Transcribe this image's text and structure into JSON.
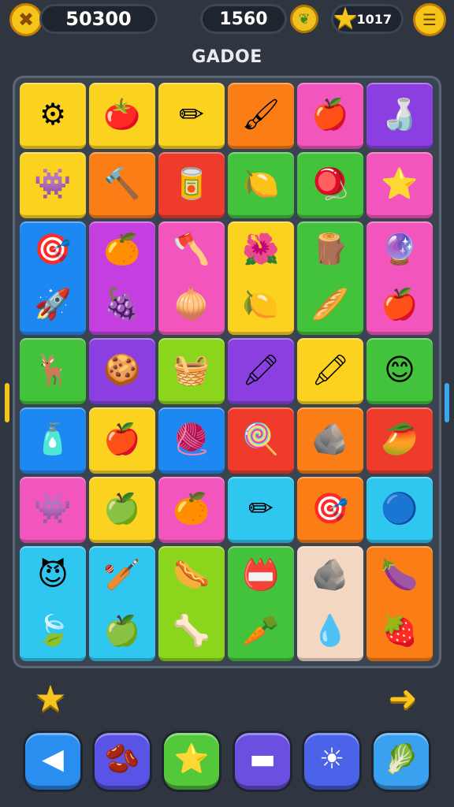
{
  "hud": {
    "score": "50300",
    "moves": "1560",
    "stars": "1017",
    "icons": {
      "menu": "puzzle-icon",
      "leaf": "leaf-coin-icon",
      "star": "star-icon",
      "settings": "settings-icon"
    }
  },
  "title": "GADOE",
  "colors": {
    "yellow": "#fbd21f",
    "orange": "#fa7d16",
    "pink": "#f255bb",
    "purple": "#8b3fe0",
    "red": "#ef3b2c",
    "green": "#43c23c",
    "blue": "#1e88f2",
    "cyan": "#2fc6f0",
    "lime": "#8bd61c",
    "magenta": "#c43ee0",
    "beige": "#f3d7c2"
  },
  "board": {
    "tiles": [
      {
        "color": "yellow",
        "items": [
          {
            "name": "gear-icon",
            "glyph": "⚙"
          }
        ]
      },
      {
        "color": "yellow",
        "items": [
          {
            "name": "tomato-face-icon",
            "glyph": "🍅"
          }
        ]
      },
      {
        "color": "yellow",
        "items": [
          {
            "name": "pen-icon",
            "glyph": "✏"
          }
        ]
      },
      {
        "color": "orange",
        "items": [
          {
            "name": "brush-icon",
            "glyph": "🖌"
          }
        ]
      },
      {
        "color": "pink",
        "items": [
          {
            "name": "apple-icon",
            "glyph": "🍎"
          }
        ]
      },
      {
        "color": "purple",
        "items": [
          {
            "name": "bottle-icon",
            "glyph": "🍶"
          }
        ]
      },
      {
        "color": "yellow",
        "items": [
          {
            "name": "pink-monster-icon",
            "glyph": "👾"
          }
        ]
      },
      {
        "color": "orange",
        "items": [
          {
            "name": "hammer-icon",
            "glyph": "🔨"
          }
        ]
      },
      {
        "color": "red",
        "items": [
          {
            "name": "can-icon",
            "glyph": "🥫"
          }
        ]
      },
      {
        "color": "green",
        "items": [
          {
            "name": "lime-icon",
            "glyph": "🍋"
          }
        ]
      },
      {
        "color": "green",
        "items": [
          {
            "name": "spinning-top-icon",
            "glyph": "🪀"
          }
        ]
      },
      {
        "color": "pink",
        "items": [
          {
            "name": "star-face-icon",
            "glyph": "⭐"
          }
        ]
      },
      {
        "color": "blue",
        "items": [
          {
            "name": "target-icon",
            "glyph": "🎯"
          },
          {
            "name": "rocket-icon",
            "glyph": "🚀"
          }
        ]
      },
      {
        "color": "magenta",
        "items": [
          {
            "name": "orange-icon",
            "glyph": "🍊"
          },
          {
            "name": "plum-icon",
            "glyph": "🍇"
          }
        ]
      },
      {
        "color": "pink",
        "items": [
          {
            "name": "axe-icon",
            "glyph": "🪓"
          },
          {
            "name": "onion-icon",
            "glyph": "🧅"
          }
        ]
      },
      {
        "color": "yellow",
        "items": [
          {
            "name": "flower-icon",
            "glyph": "🌺"
          },
          {
            "name": "lemon-icon",
            "glyph": "🍋"
          }
        ]
      },
      {
        "color": "green",
        "items": [
          {
            "name": "stump-icon",
            "glyph": "🪵"
          },
          {
            "name": "stick-icon",
            "glyph": "🥖"
          }
        ]
      },
      {
        "color": "pink",
        "items": [
          {
            "name": "blue-ball-icon",
            "glyph": "🔮"
          },
          {
            "name": "red-apple-icon",
            "glyph": "🍎"
          }
        ]
      },
      {
        "color": "green",
        "items": [
          {
            "name": "moose-face-icon",
            "glyph": "🦌"
          }
        ]
      },
      {
        "color": "purple",
        "items": [
          {
            "name": "cookie-icon",
            "glyph": "🍪"
          }
        ]
      },
      {
        "color": "lime",
        "items": [
          {
            "name": "basket-icon",
            "glyph": "🧺"
          }
        ]
      },
      {
        "color": "purple",
        "items": [
          {
            "name": "marker-icon",
            "glyph": "🖍"
          }
        ]
      },
      {
        "color": "yellow",
        "items": [
          {
            "name": "crayon-icon",
            "glyph": "🖍"
          }
        ]
      },
      {
        "color": "green",
        "items": [
          {
            "name": "smiley-icon",
            "glyph": "😊"
          }
        ]
      },
      {
        "color": "blue",
        "items": [
          {
            "name": "glue-bottle-icon",
            "glyph": "🧴"
          }
        ]
      },
      {
        "color": "yellow",
        "items": [
          {
            "name": "apple-icon",
            "glyph": "🍎"
          }
        ]
      },
      {
        "color": "blue",
        "items": [
          {
            "name": "yarn-ball-icon",
            "glyph": "🧶"
          }
        ]
      },
      {
        "color": "red",
        "items": [
          {
            "name": "lollipop-icon",
            "glyph": "🍭"
          }
        ]
      },
      {
        "color": "orange",
        "items": [
          {
            "name": "rock-face-icon",
            "glyph": "🪨"
          }
        ]
      },
      {
        "color": "red",
        "items": [
          {
            "name": "mango-icon",
            "glyph": "🥭"
          }
        ]
      },
      {
        "color": "pink",
        "items": [
          {
            "name": "pink-monster-icon",
            "glyph": "👾"
          }
        ]
      },
      {
        "color": "yellow",
        "items": [
          {
            "name": "apple-pin-icon",
            "glyph": "🍏"
          }
        ]
      },
      {
        "color": "pink",
        "items": [
          {
            "name": "orange-icon",
            "glyph": "🍊"
          }
        ]
      },
      {
        "color": "cyan",
        "items": [
          {
            "name": "pencil-icon",
            "glyph": "✏"
          }
        ]
      },
      {
        "color": "orange",
        "items": [
          {
            "name": "target-icon",
            "glyph": "🎯"
          }
        ]
      },
      {
        "color": "cyan",
        "items": [
          {
            "name": "glass-ball-icon",
            "glyph": "🔵"
          }
        ]
      },
      {
        "color": "cyan",
        "items": [
          {
            "name": "purple-monster-icon",
            "glyph": "😈"
          },
          {
            "name": "leaf-icon",
            "glyph": "🍃"
          }
        ]
      },
      {
        "color": "cyan",
        "items": [
          {
            "name": "bat-icon",
            "glyph": "🏏"
          },
          {
            "name": "green-apple-icon",
            "glyph": "🍏"
          }
        ]
      },
      {
        "color": "lime",
        "items": [
          {
            "name": "sausage-icon",
            "glyph": "🌭"
          },
          {
            "name": "bone-icon",
            "glyph": "🦴"
          }
        ]
      },
      {
        "color": "green",
        "items": [
          {
            "name": "badge-icon",
            "glyph": "📛"
          },
          {
            "name": "carrot-icon",
            "glyph": "🥕"
          }
        ]
      },
      {
        "color": "beige",
        "items": [
          {
            "name": "rock-face-icon",
            "glyph": "🪨"
          },
          {
            "name": "blue-drop-icon",
            "glyph": "💧"
          }
        ]
      },
      {
        "color": "orange",
        "items": [
          {
            "name": "purple-fruit-icon",
            "glyph": "🍆"
          },
          {
            "name": "berry-icon",
            "glyph": "🍓"
          }
        ]
      }
    ]
  },
  "controls": {
    "star_button": "star-icon",
    "next_button": "arrow-right-icon",
    "buttons": [
      {
        "name": "back-button",
        "icon": "back-arrow-icon",
        "glyph": "◀",
        "color": "#2a8ef0"
      },
      {
        "name": "bean-button",
        "icon": "bean-icon",
        "glyph": "🫘",
        "color": "#5a54e6"
      },
      {
        "name": "star-boost-button",
        "icon": "star-icon",
        "glyph": "⭐",
        "color": "#53c83a"
      },
      {
        "name": "pause-button",
        "icon": "bar-icon",
        "glyph": "▬",
        "color": "#6b4fe0"
      },
      {
        "name": "sun-button",
        "icon": "sun-icon",
        "glyph": "☀",
        "color": "#4a63e8"
      },
      {
        "name": "leaf-button",
        "icon": "leaf-bowl-icon",
        "glyph": "🥬",
        "color": "#3aa1f0"
      }
    ]
  }
}
